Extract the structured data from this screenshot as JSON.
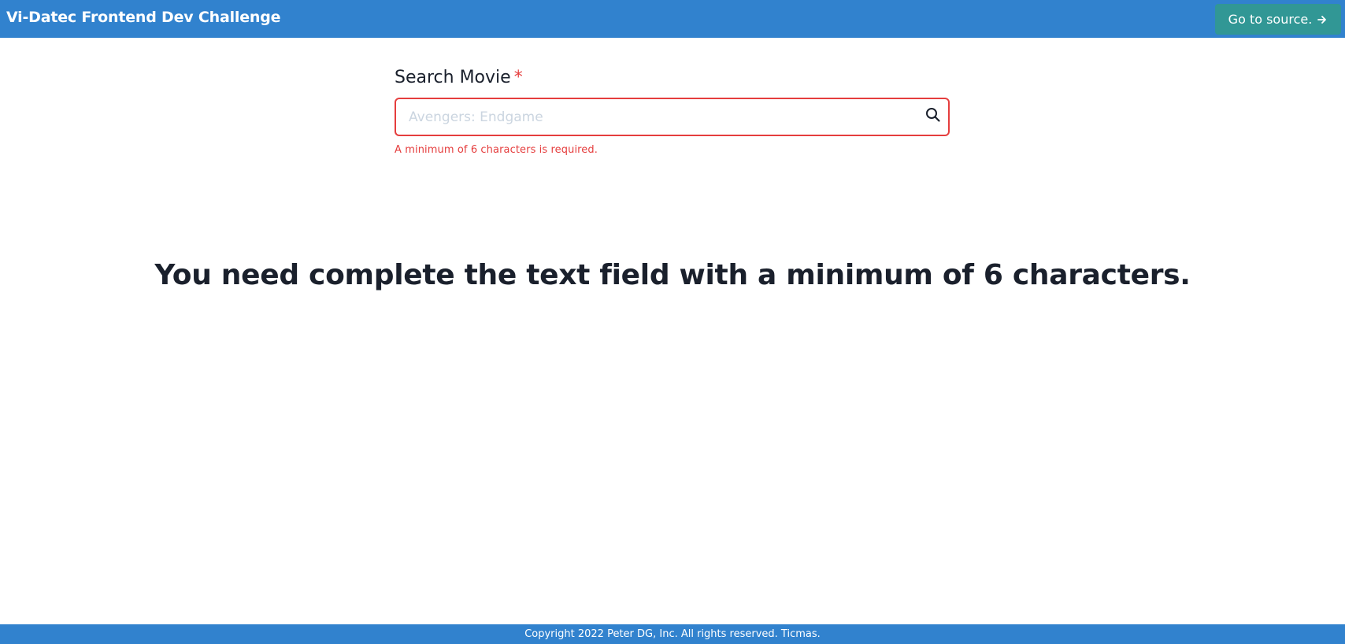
{
  "header": {
    "title": "Vi-Datec Frontend Dev Challenge",
    "source_button_label": "Go to source.",
    "source_button_icon": "arrow-right-icon"
  },
  "form": {
    "label": "Search Movie",
    "required_marker": "*",
    "input_value": "",
    "input_placeholder": "Avengers: Endgame",
    "search_icon": "search-icon",
    "error_text": "A minimum of 6 characters is required."
  },
  "main": {
    "message": "You need complete the text field with a minimum of 6 characters."
  },
  "footer": {
    "copyright": "Copyright 2022 Peter DG, Inc. All rights reserved. Ticmas."
  },
  "colors": {
    "header_bg": "#3182ce",
    "source_button_bg": "#319795",
    "error": "#e53e3e",
    "text": "#1a202c",
    "placeholder": "#cbd5e0"
  }
}
